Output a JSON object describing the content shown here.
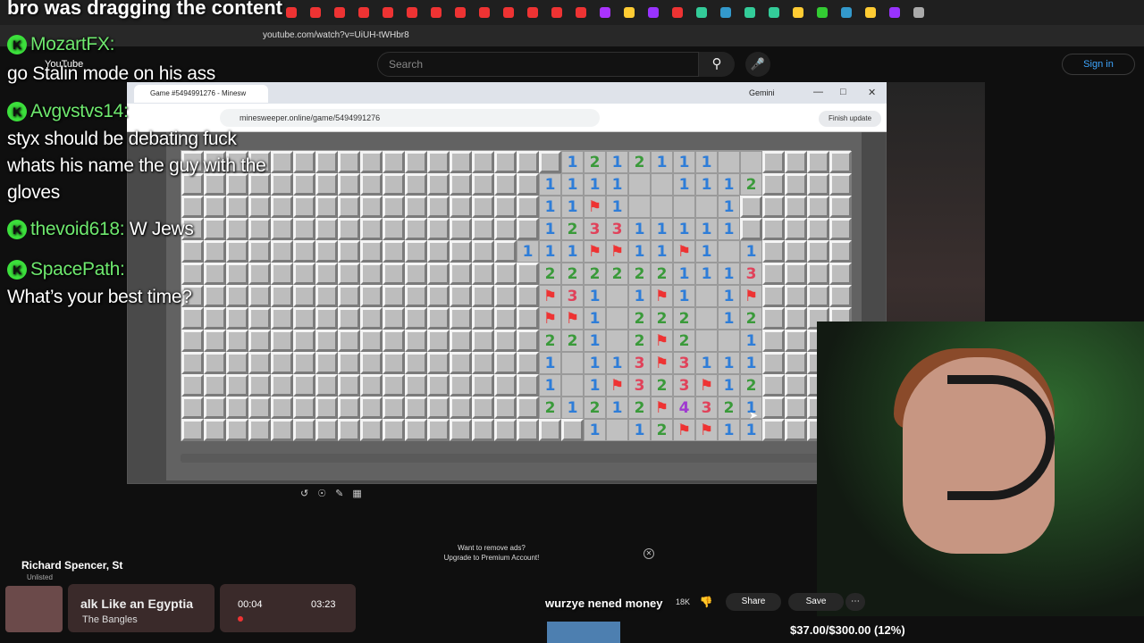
{
  "overlay": {
    "top_title": "bro was dragging the content"
  },
  "browser": {
    "url": "youtube.com/watch?v=UiUH-tWHbr8"
  },
  "youtube": {
    "logo": "YouTube",
    "search_placeholder": "Search",
    "sign_in": "Sign in",
    "video_title": "Richard Spencer, St",
    "visibility": "Unlisted",
    "likes": "18K",
    "share": "Share",
    "save": "Save"
  },
  "inner_browser": {
    "tab_title": "Game #5494991276 - Minesw",
    "url": "minesweeper.online/game/5494991276",
    "gemini": "Gemini",
    "finish_update": "Finish update"
  },
  "ad": {
    "line1": "Want to remove ads?",
    "line2": "Upgrade to Premium Account!"
  },
  "chat": [
    {
      "user": "MozartFX:",
      "message": "go Stalin mode on his ass"
    },
    {
      "user": "Avgvstvs14:",
      "message": "styx should be debating fuck"
    },
    {
      "user": "",
      "message": "whats his name the guy with the"
    },
    {
      "user": "",
      "message": "gloves"
    },
    {
      "user": "thevoid618:",
      "message": "W Jews"
    },
    {
      "user": "SpacePath:",
      "message": "What’s your best time?"
    }
  ],
  "music": {
    "song": "alk Like an Egyptia",
    "artist": "The Bangles",
    "current": "00:04",
    "duration": "03:23"
  },
  "comment_overlay": "wurzye nened money",
  "donation_goal": "$37.00/$300.00 (12%)",
  "board": {
    "cols": 30,
    "rows": 13,
    "legend": "H = hidden, . = opened empty, F = flag, digits = number",
    "grid": [
      "HHHHHHHHHHHHHHHHH1212111..HHHHHHHHH",
      "HHHHHHHHHHHHHHHH1111..1112HHHHHHHHH",
      "HHHHHHHHHHHHHHHH11F1....1HHHHHHHHH",
      "HHHHHHHHHHHHHHHH123311111HHHHHHHHH",
      "HHHHHHHHHHHHHHH111FF11F1.1HHHHHHHHH",
      "HHHHHHHHHHHHHHHH2222221113HHHHHHHHH",
      "HHHHHHHHHHHHHHHHF31.1F1.1FHHHHHHHHH",
      "HHHHHHHHHHHHHHHHFF1.222.12HHHHHHHHH",
      "HHHHHHHHHHHHHHHH221.2F2..1HHHHHHHHH",
      "HHHHHHHHHHHHHHHH1.113F3111HHHHHHHHH",
      "HHHHHHHHHHHHHHHH1.1F323F12HHHHHHHHH",
      "HHHHHHHHHHHHHHHH2121 2F4321HHHHHHHHH",
      "HHHHHHHHHHHHHHHHHH1.12FF11HHHHHHHHH"
    ]
  }
}
